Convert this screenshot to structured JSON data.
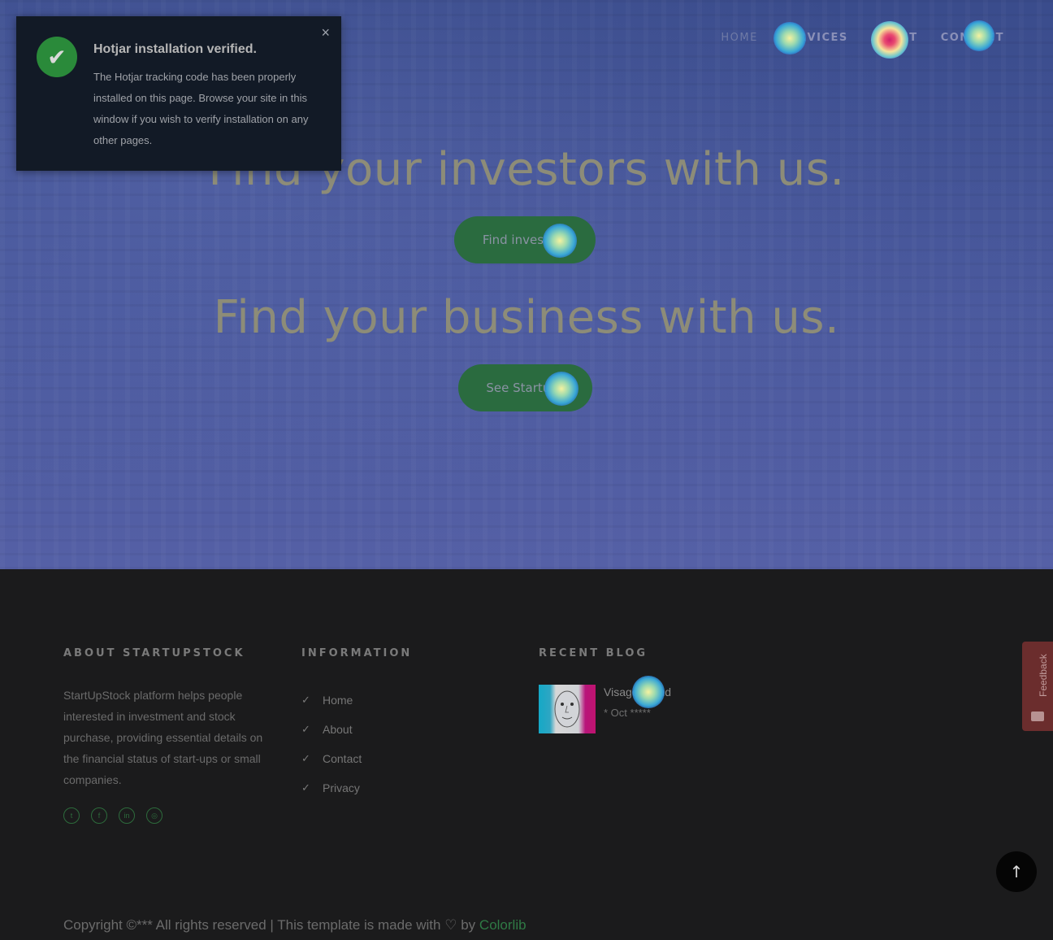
{
  "nav": {
    "items": [
      {
        "label": "HOME"
      },
      {
        "label": "SERVICES"
      },
      {
        "label": "ABOUT"
      },
      {
        "label": "CONTACT"
      }
    ]
  },
  "hero": {
    "headline1": "Find your investors with us.",
    "button1": "Find investors",
    "headline2": "Find your business with us.",
    "button2": "See Startups"
  },
  "toast": {
    "title": "Hotjar installation verified.",
    "body": "The Hotjar tracking code has been properly installed on this page. Browse your site in this window if you wish to verify installation on any other pages.",
    "close": "×",
    "icon": "check-icon"
  },
  "footer": {
    "about_title": "ABOUT STARTUPSTOCK",
    "about_text": "StartUpStock platform helps people interested in investment and stock purchase, providing essential details on the financial status of start-ups or small companies.",
    "info_title": "INFORMATION",
    "links": [
      "Home",
      "About",
      "Contact",
      "Privacy"
    ],
    "blog_title": "RECENT BLOG",
    "blog_post": {
      "title": "Visage Cloud",
      "date": "* Oct *****"
    },
    "socials": [
      "twitter-icon",
      "facebook-icon",
      "linkedin-icon",
      "dribbble-icon"
    ],
    "copyright_prefix": "Copyright ©*** All rights reserved | This template is made with",
    "copyright_by": "by",
    "copyright_link": "Colorlib"
  },
  "feedback": {
    "label": "Feedback"
  },
  "colors": {
    "accent": "#2a6b3f",
    "hero": "#46569a",
    "footer": "#1b1b1c"
  }
}
